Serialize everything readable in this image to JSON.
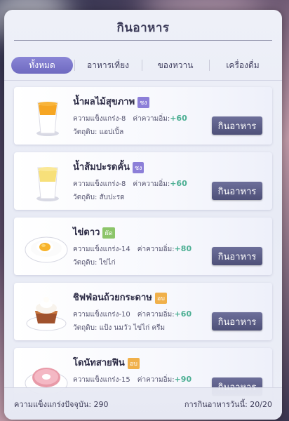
{
  "title": "กินอาหาร",
  "tabs": [
    "ทั้งหมด",
    "อาหารเที่ยง",
    "ของหวาน",
    "เครื่องดื่ม"
  ],
  "stat_labels": {
    "hunger": "ความแข็งแกร่ง",
    "fullness": "ค่าความอิ่ม:",
    "ingredients": "วัตถุดิบ:"
  },
  "button_label": "กินอาหาร",
  "items": [
    {
      "name": "น้ำผลไม้สุขภาพ",
      "tag": "ชง",
      "tag_color": "#8c7fd8",
      "hunger": "-8",
      "fullness": "+60",
      "ingredients": "แอปเปิ้ล",
      "icon": "orange-juice-icon"
    },
    {
      "name": "น้ำส้มปะรดคั้น",
      "tag": "ชง",
      "tag_color": "#8c7fd8",
      "hunger": "-8",
      "fullness": "+60",
      "ingredients": "สับปะรด",
      "icon": "pineapple-juice-icon"
    },
    {
      "name": "ไข่ดาว",
      "tag": "ผัด",
      "tag_color": "#8cc56a",
      "hunger": "-14",
      "fullness": "+80",
      "ingredients": "ไข่ไก่",
      "icon": "fried-egg-icon"
    },
    {
      "name": "ชิฟฟ่อนถ้วยกระดาษ",
      "tag": "อบ",
      "tag_color": "#f0b04a",
      "hunger": "-10",
      "fullness": "+60",
      "ingredients": "แป้ง นมวัว ไข่ไก่ ครีม",
      "icon": "cupcake-icon"
    },
    {
      "name": "โดนัทสายฟิน",
      "tag": "อบ",
      "tag_color": "#f0b04a",
      "hunger": "-15",
      "fullness": "+90",
      "ingredients": "",
      "icon": "donut-icon"
    }
  ],
  "footer": {
    "left": "ความแข็งแกร่งปัจจุบัน: 290",
    "right": "การกินอาหารวันนี้: 20/20"
  }
}
